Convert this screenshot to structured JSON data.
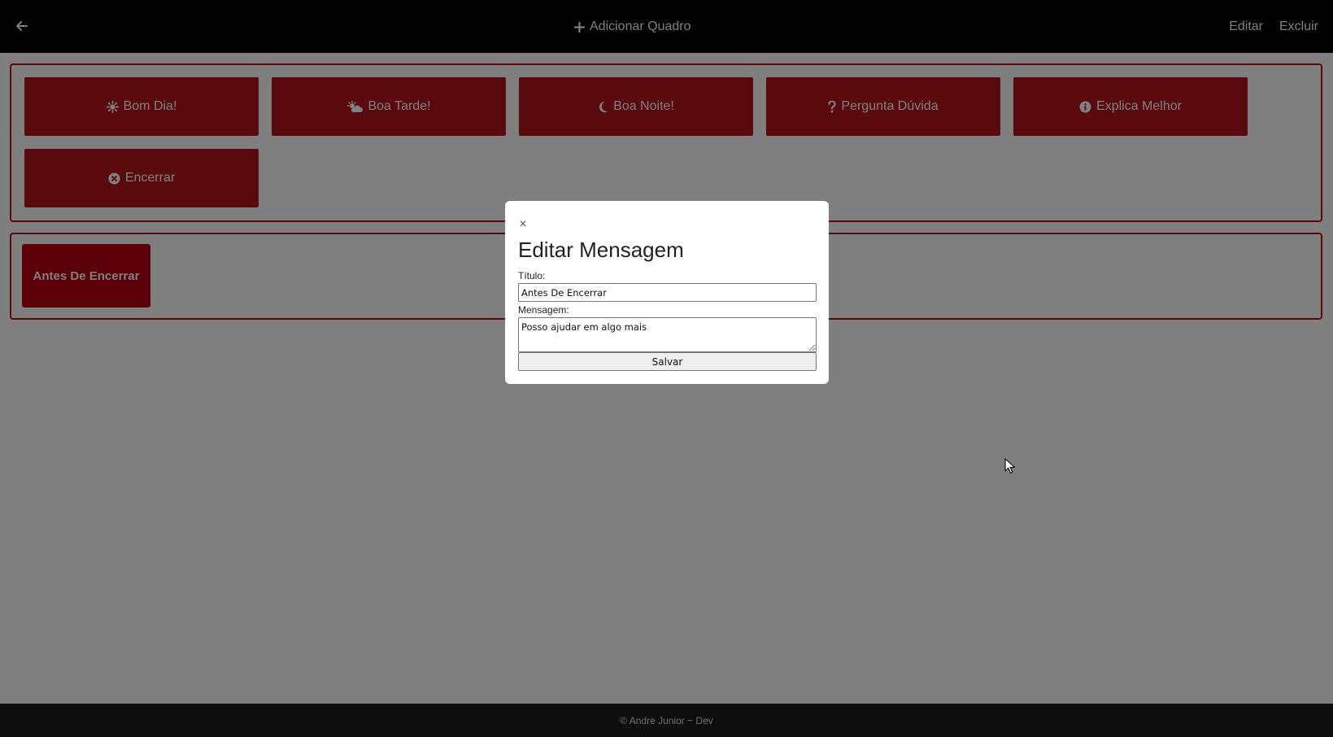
{
  "navbar": {
    "back_icon": "arrow-left-icon",
    "add_board_icon": "plus-icon",
    "add_board_label": "Adicionar Quadro",
    "edit_label": "Editar",
    "delete_label": "Excluir"
  },
  "boards": [
    {
      "buttons": [
        {
          "label": "Bom Dia!",
          "icon": "sun-icon"
        },
        {
          "label": "Boa Tarde!",
          "icon": "cloud-sun-icon"
        },
        {
          "label": "Boa Noite!",
          "icon": "moon-icon"
        },
        {
          "label": "Pergunta Dúvida",
          "icon": "question-icon"
        },
        {
          "label": "Explica Melhor",
          "icon": "info-circle-icon"
        },
        {
          "label": "Encerrar",
          "icon": "times-circle-icon"
        }
      ]
    },
    {
      "cards": [
        {
          "label": "Antes De Encerrar"
        }
      ]
    }
  ],
  "modal": {
    "close_symbol": "×",
    "title": "Editar Mensagem",
    "title_label": "Título:",
    "title_value": "Antes De Encerrar",
    "message_label": "Mensagem:",
    "message_value": "Posso ajudar em algo mais",
    "save_label": "Salvar"
  },
  "footer": {
    "text": "© Andre Junior ~ Dev"
  },
  "colors": {
    "accent": "#b5121b",
    "card": "#b70012",
    "navbar": "#000000",
    "footer": "#1a1a1a",
    "overlay": "rgba(0,0,0,0.5)"
  }
}
